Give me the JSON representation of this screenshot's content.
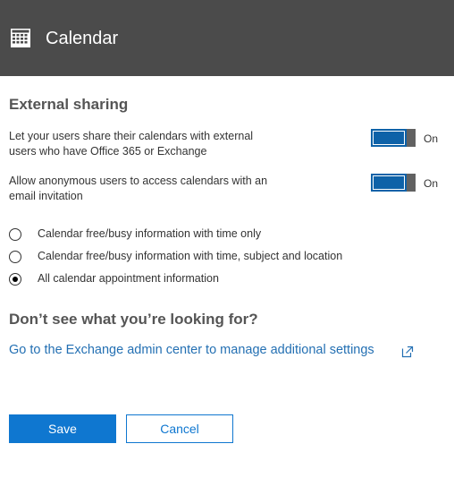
{
  "header": {
    "title": "Calendar",
    "icon": "calendar-icon",
    "background": "#4b4b4b"
  },
  "external_sharing": {
    "title": "External sharing",
    "settings": [
      {
        "line1": "Let your users share their calendars with external",
        "line2": "users who have Office 365 or Exchange",
        "toggle_state": "On",
        "enabled": true
      },
      {
        "line1": "Allow anonymous users to access calendars with an",
        "line2": "email invitation",
        "toggle_state": "On",
        "enabled": true
      }
    ],
    "options": [
      {
        "label": "Calendar free/busy information with time only",
        "selected": false
      },
      {
        "label": "Calendar free/busy information with time, subject and location",
        "selected": false
      },
      {
        "label": "All calendar appointment information",
        "selected": true
      }
    ]
  },
  "help": {
    "heading": "Don’t see what you’re looking for?",
    "link_text": "Go to the Exchange admin center to manage additional settings",
    "link_icon": "external-link-icon"
  },
  "buttons": {
    "save_label": "Save",
    "cancel_label": "Cancel"
  },
  "colors": {
    "accent": "#0f77d0",
    "toggle_on": "#0e62a8",
    "link": "#2470b3"
  }
}
